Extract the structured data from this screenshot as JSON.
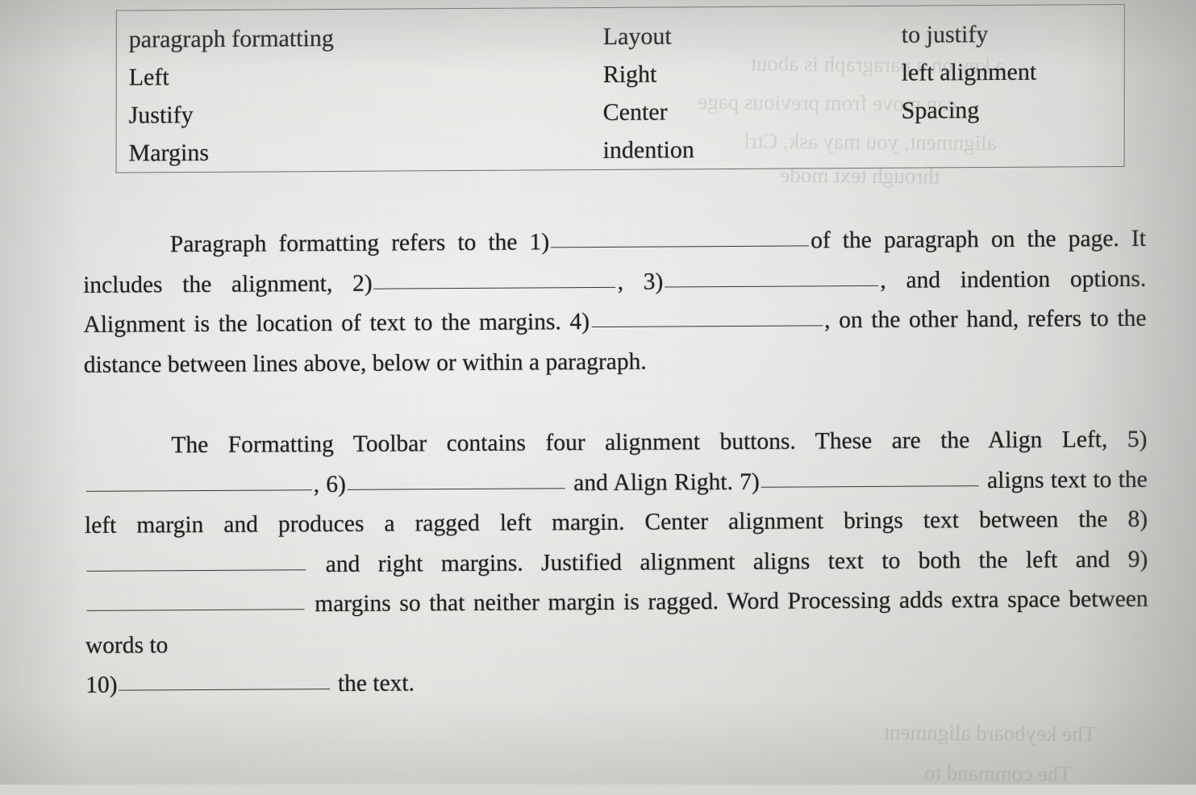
{
  "page": {
    "background_color": "#d8d7d4",
    "ink_color": "#1f1e1c",
    "border_color": "#6e6e6c"
  },
  "word_bank": {
    "name": "word-bank",
    "rows": [
      {
        "col1": "paragraph formatting",
        "col2": "Layout",
        "col3": "to justify"
      },
      {
        "col1": "Left",
        "col2": "Right",
        "col3": "left alignment"
      },
      {
        "col1": "Justify",
        "col2": "Center",
        "col3": "Spacing"
      },
      {
        "col1": "Margins",
        "col2": "indention",
        "col3": ""
      }
    ]
  },
  "paragraph_1": {
    "s1": "Paragraph formatting refers to the 1)",
    "s2": "of the paragraph on the page. It includes the alignment, 2)",
    "s3": ",",
    "s4": "3)",
    "s5": ", and indention options. Alignment is the location of text to the margins. 4)",
    "s6": ", on the other hand, refers to the distance between lines above, below or within a paragraph."
  },
  "paragraph_2": {
    "s1": "The Formatting Toolbar contains four alignment buttons. These are the Align Left, 5)",
    "s2": ", 6)",
    "s3": "and Align Right. 7)",
    "s4": "aligns text to the left margin and produces a ragged left margin. Center alignment brings text between the",
    "s5": "8)",
    "s6": "and right margins. Justified alignment aligns text to both the left  and 9)",
    "s7": "margins so that neither margin is ragged. Word Processing adds extra space between words to",
    "s8": "10)",
    "s9": "the text."
  },
  "blanks": [
    {
      "number": "1)",
      "name": "blank-1",
      "value": ""
    },
    {
      "number": "2)",
      "name": "blank-2",
      "value": ""
    },
    {
      "number": "3)",
      "name": "blank-3",
      "value": ""
    },
    {
      "number": "4)",
      "name": "blank-4",
      "value": ""
    },
    {
      "number": "5)",
      "name": "blank-5",
      "value": ""
    },
    {
      "number": "6)",
      "name": "blank-6",
      "value": ""
    },
    {
      "number": "7)",
      "name": "blank-7",
      "value": ""
    },
    {
      "number": "8)",
      "name": "blank-8",
      "value": ""
    },
    {
      "number": "9)",
      "name": "blank-9",
      "value": ""
    },
    {
      "number": "10)",
      "name": "blank-10",
      "value": ""
    }
  ],
  "show_through": {
    "lines": [
      "a key on a paragraph is about",
      "can move from previous page",
      "alignment, you may ask, Ctrl",
      "through text mode",
      "The keyboard alignment",
      "The command to"
    ]
  }
}
